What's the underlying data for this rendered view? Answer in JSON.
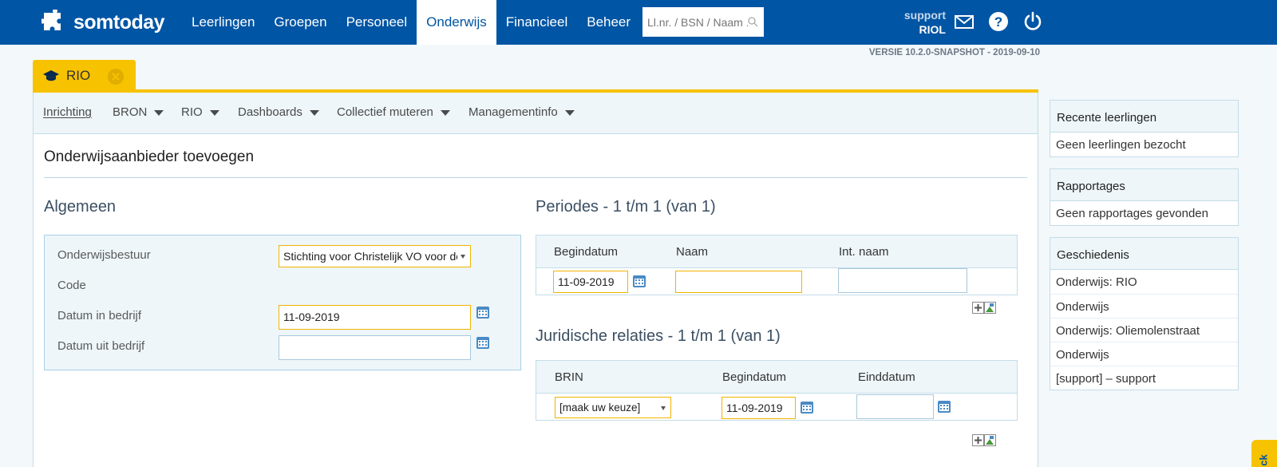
{
  "topbar": {
    "logo_text": "somtoday",
    "nav": [
      "Leerlingen",
      "Groepen",
      "Personeel",
      "Onderwijs",
      "Financieel",
      "Beheer"
    ],
    "active_nav": "Onderwijs",
    "search_placeholder": "Ll.nr. / BSN / Naam ...",
    "user_line1": "support",
    "user_line2": "RIOL",
    "brand_color": "#0055a4"
  },
  "version": "VERSIE 10.2.0-SNAPSHOT - 2019-09-10",
  "tab": {
    "label": "RIO",
    "color": "#f7c200"
  },
  "subnav": {
    "items": [
      {
        "label": "Inrichting"
      },
      {
        "label": "BRON"
      },
      {
        "label": "RIO"
      },
      {
        "label": "Dashboards"
      },
      {
        "label": "Collectief muteren"
      },
      {
        "label": "Managementinfo"
      }
    ]
  },
  "page_title": "Onderwijsaanbieder toevoegen",
  "algemeen": {
    "heading": "Algemeen",
    "onderwijsbestuur_label": "Onderwijsbestuur",
    "onderwijsbestuur_value": "Stichting voor Christelijk VO voor de r",
    "code_label": "Code",
    "datum_in_label": "Datum in bedrijf",
    "datum_in_value": "11-09-2019",
    "datum_uit_label": "Datum uit bedrijf",
    "datum_uit_value": ""
  },
  "periodes": {
    "heading": "Periodes - 1 t/m 1 (van 1)",
    "columns": [
      "Begindatum",
      "Naam",
      "Int. naam"
    ],
    "row": {
      "begindatum": "11-09-2019",
      "naam": "",
      "int_naam": ""
    }
  },
  "juridisch": {
    "heading": "Juridische relaties - 1 t/m 1 (van 1)",
    "columns": [
      "BRIN",
      "Begindatum",
      "Einddatum"
    ],
    "row": {
      "brin": "[maak uw keuze]",
      "begindatum": "11-09-2019",
      "einddatum": ""
    }
  },
  "sidebar": {
    "recent": {
      "title": "Recente leerlingen",
      "items": [
        "Geen leerlingen bezocht"
      ]
    },
    "rapportages": {
      "title": "Rapportages",
      "items": [
        "Geen rapportages gevonden"
      ]
    },
    "geschiedenis": {
      "title": "Geschiedenis",
      "items": [
        "Onderwijs: RIO",
        "Onderwijs",
        "Onderwijs: Oliemolenstraat",
        "Onderwijs",
        "[support] – support"
      ]
    }
  },
  "feedback_label": "ck"
}
